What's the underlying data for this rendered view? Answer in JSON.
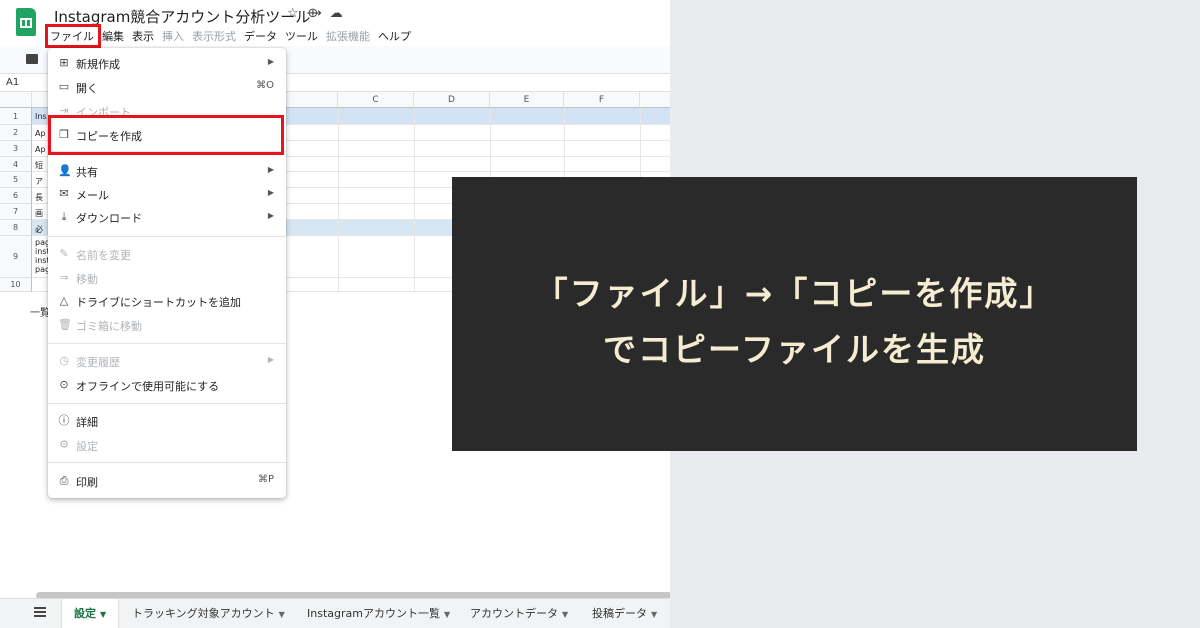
{
  "app": {
    "title": "Instagram競合アカウント分析ツール",
    "title_icons": [
      "star-icon",
      "move-to-folder-icon",
      "cloud-status-icon"
    ],
    "title_icon_glyphs": [
      "☆",
      "⟴",
      "☁"
    ],
    "menubar": [
      "ファイル",
      "編集",
      "表示",
      "挿入",
      "表示形式",
      "データ",
      "ツール",
      "拡張機能",
      "ヘルプ"
    ],
    "menubar_disabled": [
      3,
      4,
      7
    ],
    "cell_ref": "A1",
    "columns": [
      "C",
      "D",
      "E",
      "F"
    ],
    "rows": [
      "1",
      "2",
      "3",
      "4",
      "5",
      "6",
      "7",
      "8",
      "9",
      "10"
    ],
    "cells_partial": [
      "Ins",
      "Ap",
      "Ap",
      "短",
      "ア",
      "長",
      "画",
      "必",
      "pag",
      "inst",
      "inst",
      "pag"
    ],
    "below_grid_text": "一覧"
  },
  "file_menu": {
    "items": [
      {
        "icon": "new-icon",
        "glyph": "⊞",
        "label": "新規作成",
        "submenu": true,
        "disabled": false
      },
      {
        "icon": "folder-icon",
        "glyph": "▭",
        "label": "開く",
        "shortcut": "⌘O",
        "disabled": false
      },
      {
        "icon": "import-icon",
        "glyph": "⇥",
        "label": "インポート",
        "disabled": true
      },
      {
        "icon": "copy-icon",
        "glyph": "❐",
        "label": "コピーを作成",
        "disabled": false
      },
      {
        "icon": "share-icon",
        "glyph": "👤",
        "label": "共有",
        "submenu": true,
        "disabled": false
      },
      {
        "icon": "mail-icon",
        "glyph": "✉",
        "label": "メール",
        "submenu": true,
        "disabled": false
      },
      {
        "icon": "download-icon",
        "glyph": "⤓",
        "label": "ダウンロード",
        "submenu": true,
        "disabled": false
      },
      {
        "icon": "rename-icon",
        "glyph": "✎",
        "label": "名前を変更",
        "disabled": true
      },
      {
        "icon": "move-icon",
        "glyph": "⇒",
        "label": "移動",
        "disabled": true
      },
      {
        "icon": "drive-shortcut-icon",
        "glyph": "△",
        "label": "ドライブにショートカットを追加",
        "disabled": false
      },
      {
        "icon": "trash-icon",
        "glyph": "🗑",
        "label": "ゴミ箱に移動",
        "disabled": true
      },
      {
        "icon": "history-icon",
        "glyph": "◷",
        "label": "変更履歴",
        "submenu": true,
        "disabled": true
      },
      {
        "icon": "offline-icon",
        "glyph": "⊙",
        "label": "オフラインで使用可能にする",
        "disabled": false
      },
      {
        "icon": "info-icon",
        "glyph": "ⓘ",
        "label": "詳細",
        "disabled": false
      },
      {
        "icon": "settings-icon",
        "glyph": "⚙",
        "label": "設定",
        "disabled": true
      },
      {
        "icon": "print-icon",
        "glyph": "⎙",
        "label": "印刷",
        "shortcut": "⌘P",
        "disabled": false
      }
    ]
  },
  "tabs": [
    "設定",
    "トラッキング対象アカウント",
    "Instagramアカウント一覧",
    "アカウントデータ",
    "投稿データ"
  ],
  "overlay": {
    "line1": "「ファイル」→「コピーを作成」",
    "line2": "でコピーファイルを生成"
  },
  "colors": {
    "highlight": "#e8141b",
    "overlay_bg": "#2a2a2a",
    "overlay_text": "#f6ecd2",
    "sheets_green": "#1fa463"
  }
}
